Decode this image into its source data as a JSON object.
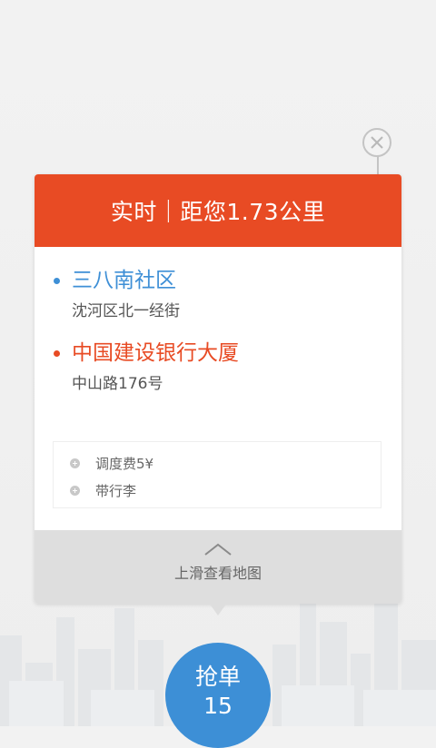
{
  "popup": {
    "header_text": "实时｜距您1.73公里",
    "route": {
      "from": {
        "name": "三八南社区",
        "address": "沈河区北一经街"
      },
      "to": {
        "name": "中国建设银行大厦",
        "address": "中山路176号"
      }
    },
    "extras": [
      {
        "label": "调度费5¥"
      },
      {
        "label": "带行李"
      }
    ],
    "footer_hint": "上滑查看地图"
  },
  "grab_button": {
    "label": "抢单",
    "countdown": "15"
  },
  "icons": {
    "close": "close-icon",
    "plus": "plus-circle-icon",
    "chevron": "chevron-up-icon"
  },
  "colors": {
    "header_orange": "#e84b24",
    "origin_blue": "#3e8fd6",
    "destination_orange": "#e84b24",
    "button_blue": "#3d8fd6"
  }
}
